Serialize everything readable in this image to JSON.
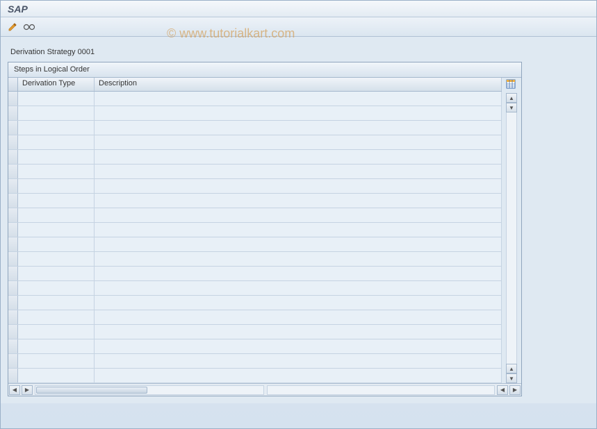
{
  "app": {
    "title": "SAP"
  },
  "watermark": "© www.tutorialkart.com",
  "subtitle": "Derivation Strategy 0001",
  "panel": {
    "header": "Steps in Logical Order",
    "columns": {
      "derivation_type": "Derivation Type",
      "description": "Description"
    },
    "rows": [
      {
        "type": "",
        "desc": ""
      },
      {
        "type": "",
        "desc": ""
      },
      {
        "type": "",
        "desc": ""
      },
      {
        "type": "",
        "desc": ""
      },
      {
        "type": "",
        "desc": ""
      },
      {
        "type": "",
        "desc": ""
      },
      {
        "type": "",
        "desc": ""
      },
      {
        "type": "",
        "desc": ""
      },
      {
        "type": "",
        "desc": ""
      },
      {
        "type": "",
        "desc": ""
      },
      {
        "type": "",
        "desc": ""
      },
      {
        "type": "",
        "desc": ""
      },
      {
        "type": "",
        "desc": ""
      },
      {
        "type": "",
        "desc": ""
      },
      {
        "type": "",
        "desc": ""
      },
      {
        "type": "",
        "desc": ""
      },
      {
        "type": "",
        "desc": ""
      },
      {
        "type": "",
        "desc": ""
      },
      {
        "type": "",
        "desc": ""
      },
      {
        "type": "",
        "desc": ""
      }
    ]
  },
  "icons": {
    "edit": "pencil-icon",
    "glasses": "glasses-icon",
    "config": "table-config-icon"
  }
}
